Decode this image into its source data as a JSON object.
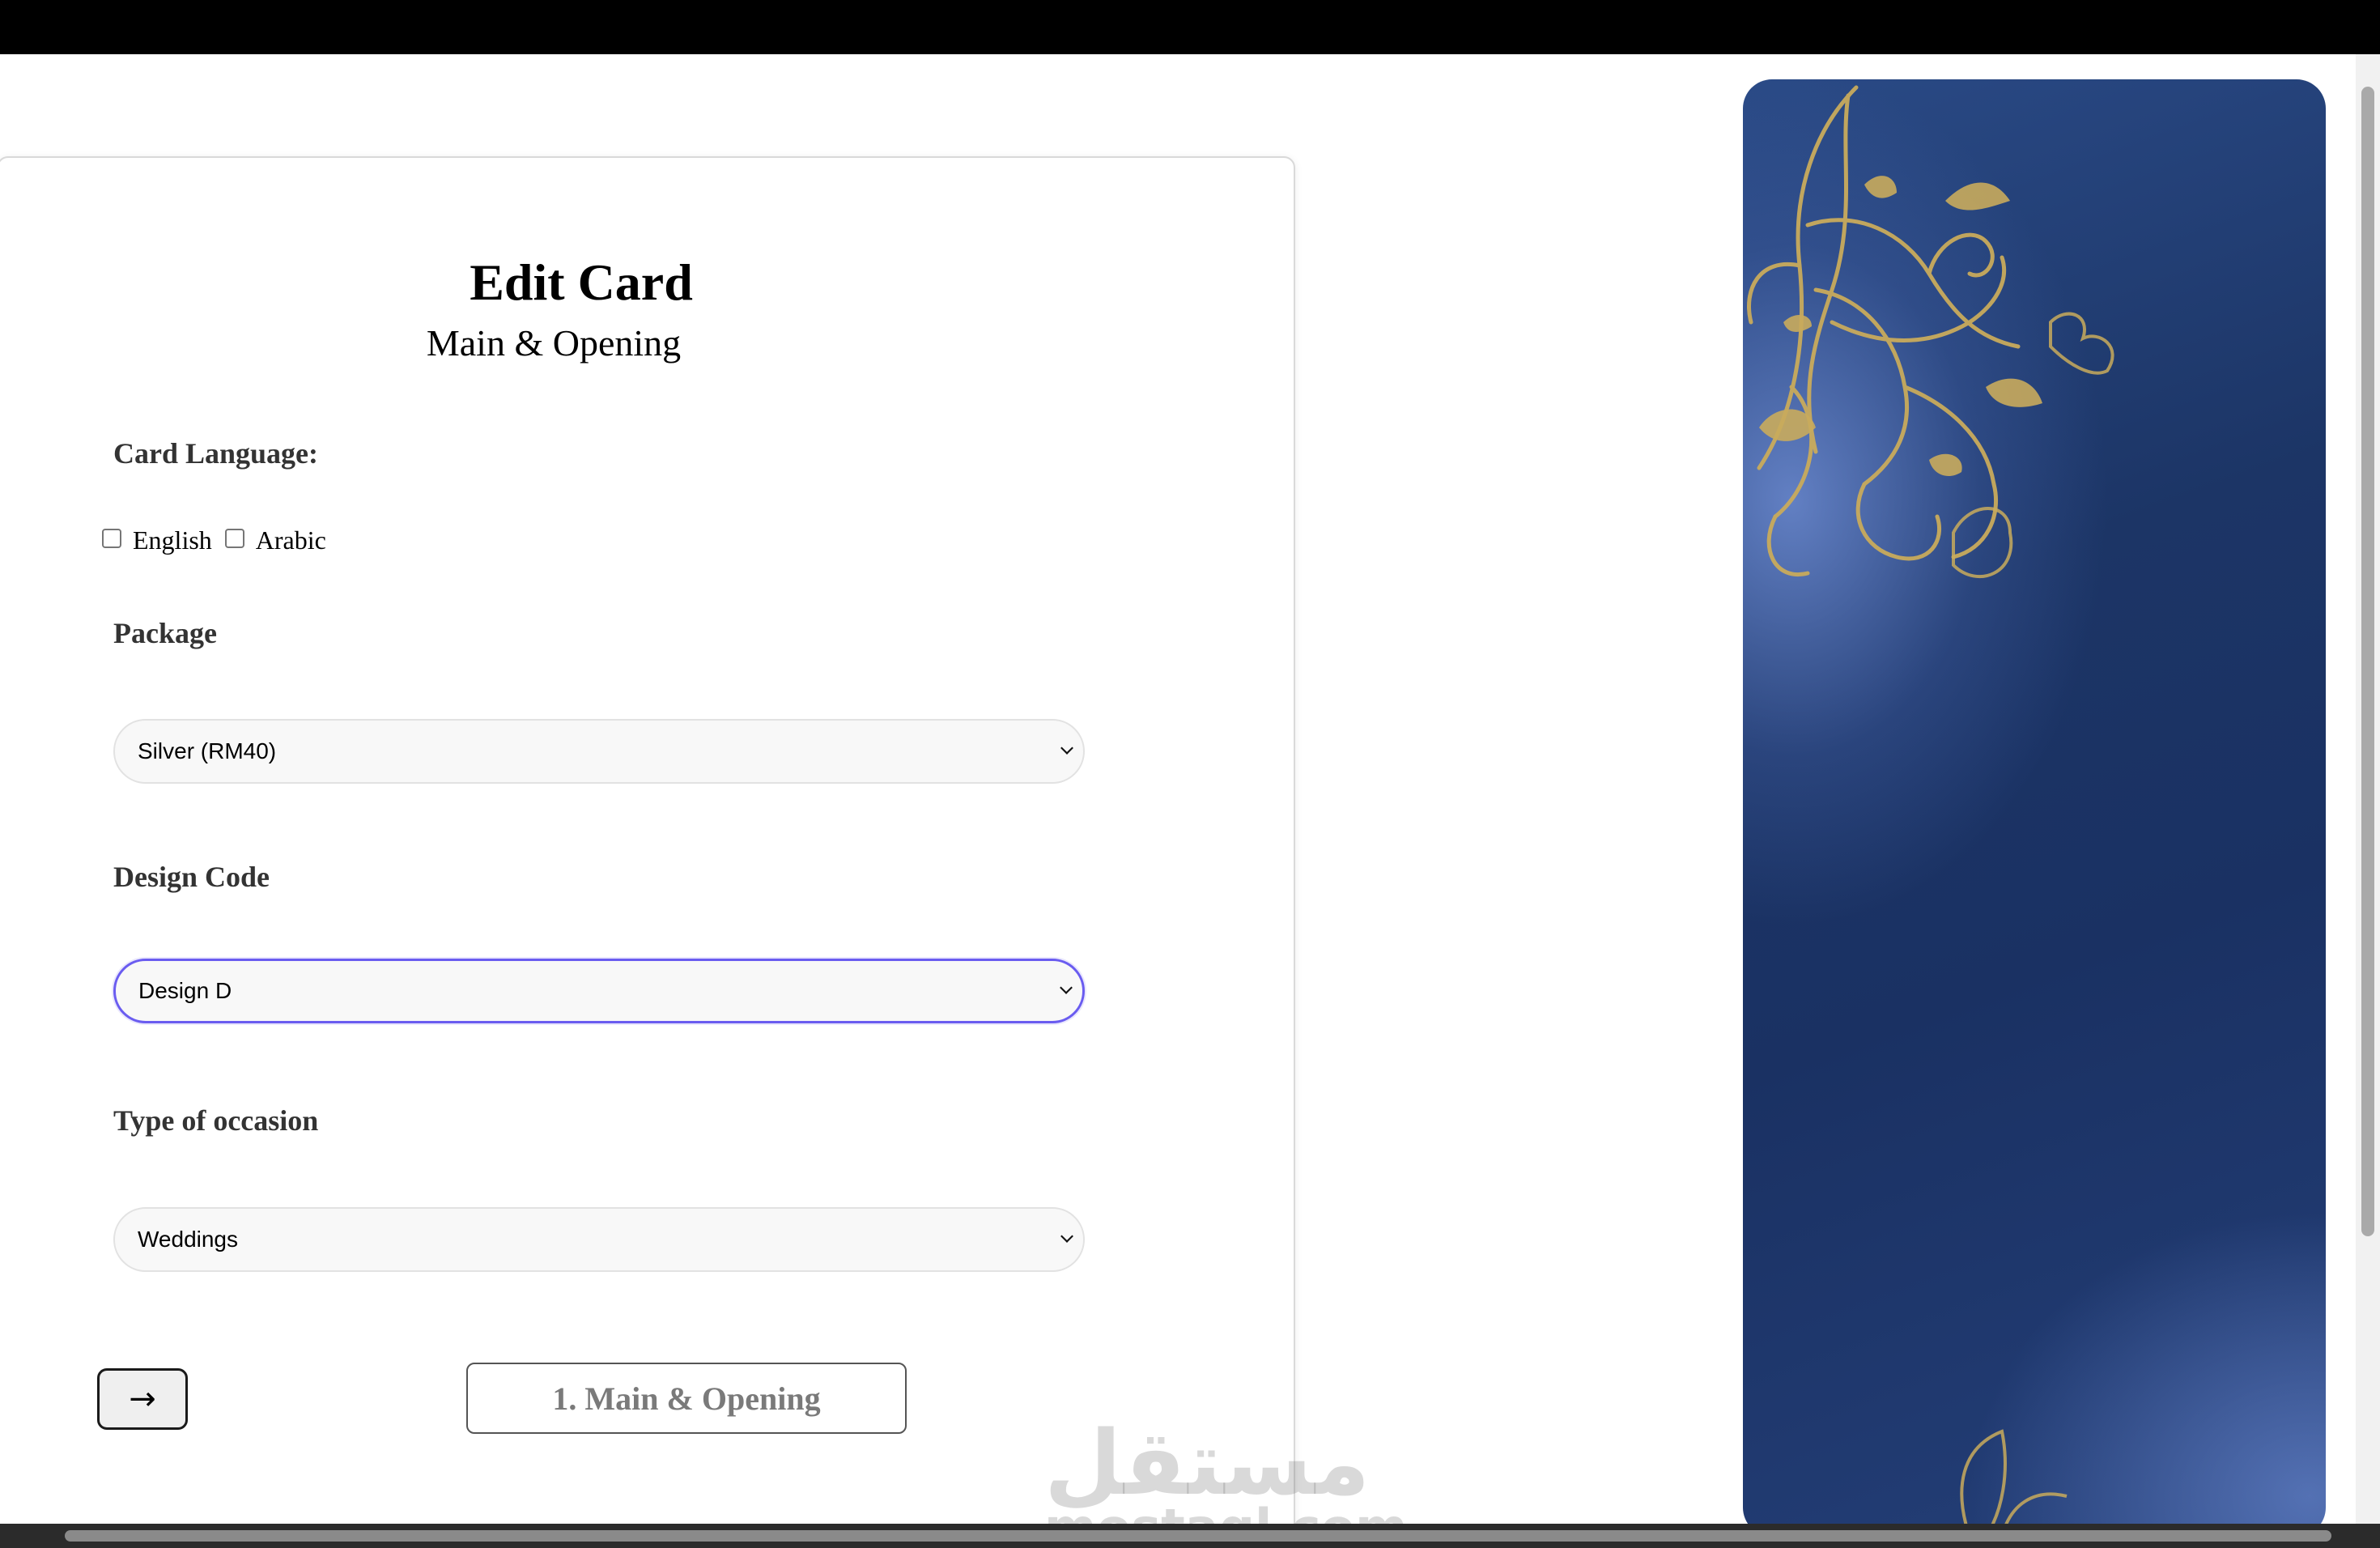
{
  "form": {
    "title": "Edit Card",
    "subtitle": "Main & Opening",
    "card_language": {
      "label": "Card Language:",
      "options": [
        "English",
        "Arabic"
      ]
    },
    "package": {
      "label": "Package",
      "selected": "Silver (RM40)"
    },
    "design_code": {
      "label": "Design Code",
      "selected": "Design D"
    },
    "occasion": {
      "label": "Type of occasion",
      "selected": "Weddings"
    },
    "next_button": "→",
    "step_button": "1. Main & Opening"
  },
  "watermark": {
    "arabic": "مستقل",
    "latin": "mostaql.com"
  },
  "colors": {
    "focus_border": "#6a5cf0",
    "preview_blue": "#1c3566",
    "gold": "#c9ab5c"
  }
}
